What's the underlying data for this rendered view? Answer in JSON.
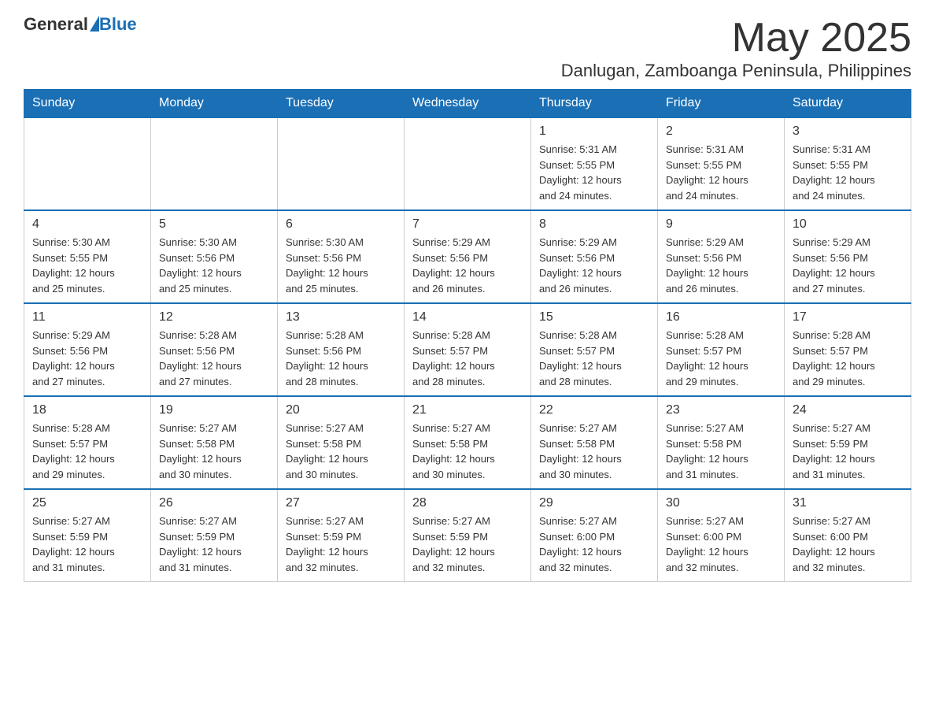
{
  "header": {
    "logo": {
      "general": "General",
      "blue": "Blue"
    },
    "title": "May 2025",
    "subtitle": "Danlugan, Zamboanga Peninsula, Philippines"
  },
  "days_of_week": [
    "Sunday",
    "Monday",
    "Tuesday",
    "Wednesday",
    "Thursday",
    "Friday",
    "Saturday"
  ],
  "weeks": [
    [
      {
        "day": "",
        "info": ""
      },
      {
        "day": "",
        "info": ""
      },
      {
        "day": "",
        "info": ""
      },
      {
        "day": "",
        "info": ""
      },
      {
        "day": "1",
        "info": "Sunrise: 5:31 AM\nSunset: 5:55 PM\nDaylight: 12 hours\nand 24 minutes."
      },
      {
        "day": "2",
        "info": "Sunrise: 5:31 AM\nSunset: 5:55 PM\nDaylight: 12 hours\nand 24 minutes."
      },
      {
        "day": "3",
        "info": "Sunrise: 5:31 AM\nSunset: 5:55 PM\nDaylight: 12 hours\nand 24 minutes."
      }
    ],
    [
      {
        "day": "4",
        "info": "Sunrise: 5:30 AM\nSunset: 5:55 PM\nDaylight: 12 hours\nand 25 minutes."
      },
      {
        "day": "5",
        "info": "Sunrise: 5:30 AM\nSunset: 5:56 PM\nDaylight: 12 hours\nand 25 minutes."
      },
      {
        "day": "6",
        "info": "Sunrise: 5:30 AM\nSunset: 5:56 PM\nDaylight: 12 hours\nand 25 minutes."
      },
      {
        "day": "7",
        "info": "Sunrise: 5:29 AM\nSunset: 5:56 PM\nDaylight: 12 hours\nand 26 minutes."
      },
      {
        "day": "8",
        "info": "Sunrise: 5:29 AM\nSunset: 5:56 PM\nDaylight: 12 hours\nand 26 minutes."
      },
      {
        "day": "9",
        "info": "Sunrise: 5:29 AM\nSunset: 5:56 PM\nDaylight: 12 hours\nand 26 minutes."
      },
      {
        "day": "10",
        "info": "Sunrise: 5:29 AM\nSunset: 5:56 PM\nDaylight: 12 hours\nand 27 minutes."
      }
    ],
    [
      {
        "day": "11",
        "info": "Sunrise: 5:29 AM\nSunset: 5:56 PM\nDaylight: 12 hours\nand 27 minutes."
      },
      {
        "day": "12",
        "info": "Sunrise: 5:28 AM\nSunset: 5:56 PM\nDaylight: 12 hours\nand 27 minutes."
      },
      {
        "day": "13",
        "info": "Sunrise: 5:28 AM\nSunset: 5:56 PM\nDaylight: 12 hours\nand 28 minutes."
      },
      {
        "day": "14",
        "info": "Sunrise: 5:28 AM\nSunset: 5:57 PM\nDaylight: 12 hours\nand 28 minutes."
      },
      {
        "day": "15",
        "info": "Sunrise: 5:28 AM\nSunset: 5:57 PM\nDaylight: 12 hours\nand 28 minutes."
      },
      {
        "day": "16",
        "info": "Sunrise: 5:28 AM\nSunset: 5:57 PM\nDaylight: 12 hours\nand 29 minutes."
      },
      {
        "day": "17",
        "info": "Sunrise: 5:28 AM\nSunset: 5:57 PM\nDaylight: 12 hours\nand 29 minutes."
      }
    ],
    [
      {
        "day": "18",
        "info": "Sunrise: 5:28 AM\nSunset: 5:57 PM\nDaylight: 12 hours\nand 29 minutes."
      },
      {
        "day": "19",
        "info": "Sunrise: 5:27 AM\nSunset: 5:58 PM\nDaylight: 12 hours\nand 30 minutes."
      },
      {
        "day": "20",
        "info": "Sunrise: 5:27 AM\nSunset: 5:58 PM\nDaylight: 12 hours\nand 30 minutes."
      },
      {
        "day": "21",
        "info": "Sunrise: 5:27 AM\nSunset: 5:58 PM\nDaylight: 12 hours\nand 30 minutes."
      },
      {
        "day": "22",
        "info": "Sunrise: 5:27 AM\nSunset: 5:58 PM\nDaylight: 12 hours\nand 30 minutes."
      },
      {
        "day": "23",
        "info": "Sunrise: 5:27 AM\nSunset: 5:58 PM\nDaylight: 12 hours\nand 31 minutes."
      },
      {
        "day": "24",
        "info": "Sunrise: 5:27 AM\nSunset: 5:59 PM\nDaylight: 12 hours\nand 31 minutes."
      }
    ],
    [
      {
        "day": "25",
        "info": "Sunrise: 5:27 AM\nSunset: 5:59 PM\nDaylight: 12 hours\nand 31 minutes."
      },
      {
        "day": "26",
        "info": "Sunrise: 5:27 AM\nSunset: 5:59 PM\nDaylight: 12 hours\nand 31 minutes."
      },
      {
        "day": "27",
        "info": "Sunrise: 5:27 AM\nSunset: 5:59 PM\nDaylight: 12 hours\nand 32 minutes."
      },
      {
        "day": "28",
        "info": "Sunrise: 5:27 AM\nSunset: 5:59 PM\nDaylight: 12 hours\nand 32 minutes."
      },
      {
        "day": "29",
        "info": "Sunrise: 5:27 AM\nSunset: 6:00 PM\nDaylight: 12 hours\nand 32 minutes."
      },
      {
        "day": "30",
        "info": "Sunrise: 5:27 AM\nSunset: 6:00 PM\nDaylight: 12 hours\nand 32 minutes."
      },
      {
        "day": "31",
        "info": "Sunrise: 5:27 AM\nSunset: 6:00 PM\nDaylight: 12 hours\nand 32 minutes."
      }
    ]
  ]
}
